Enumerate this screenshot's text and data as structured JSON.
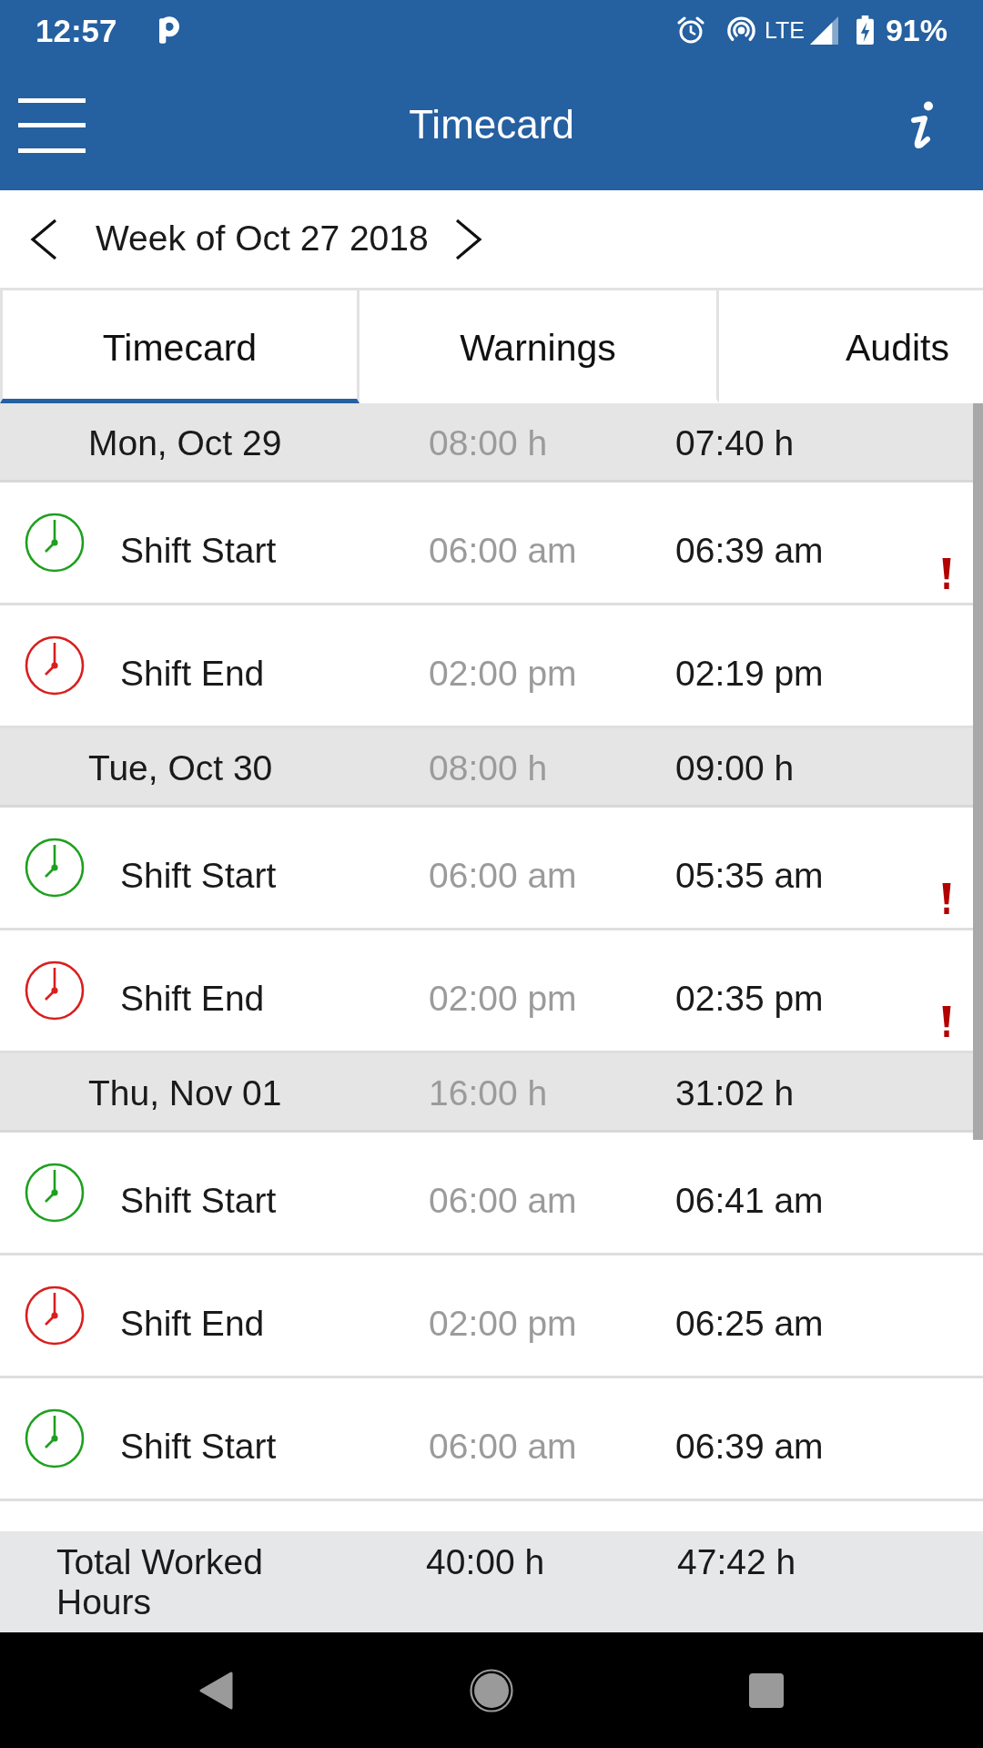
{
  "status_bar": {
    "time": "12:57",
    "network": "LTE",
    "battery": "91%"
  },
  "app_bar": {
    "title": "Timecard"
  },
  "week_nav": {
    "label": "Week of Oct 27 2018"
  },
  "tabs": [
    {
      "label": "Timecard",
      "selected": true
    },
    {
      "label": "Warnings",
      "selected": false
    },
    {
      "label": "Audits",
      "selected": false
    }
  ],
  "days": [
    {
      "date": "Mon, Oct 29",
      "planned": "08:00 h",
      "worked": "07:40 h",
      "entries": [
        {
          "label": "Shift Start",
          "planned": "06:00 am",
          "actual": "06:39 am",
          "color": "#1ea01e",
          "warning": true
        },
        {
          "label": "Shift End",
          "planned": "02:00 pm",
          "actual": "02:19 pm",
          "color": "#d91e1e",
          "warning": false
        }
      ]
    },
    {
      "date": "Tue, Oct 30",
      "planned": "08:00 h",
      "worked": "09:00 h",
      "entries": [
        {
          "label": "Shift Start",
          "planned": "06:00 am",
          "actual": "05:35 am",
          "color": "#1ea01e",
          "warning": true
        },
        {
          "label": "Shift End",
          "planned": "02:00 pm",
          "actual": "02:35 pm",
          "color": "#d91e1e",
          "warning": true
        }
      ]
    },
    {
      "date": "Thu, Nov 01",
      "planned": "16:00 h",
      "worked": "31:02 h",
      "entries": [
        {
          "label": "Shift Start",
          "planned": "06:00 am",
          "actual": "06:41 am",
          "color": "#1ea01e",
          "warning": false
        },
        {
          "label": "Shift End",
          "planned": "02:00 pm",
          "actual": "06:25 am",
          "color": "#d91e1e",
          "warning": false
        },
        {
          "label": "Shift Start",
          "planned": "06:00 am",
          "actual": "06:39 am",
          "color": "#1ea01e",
          "warning": false
        }
      ]
    }
  ],
  "total": {
    "label": "Total Worked Hours",
    "planned": "40:00 h",
    "worked": "47:42 h"
  }
}
